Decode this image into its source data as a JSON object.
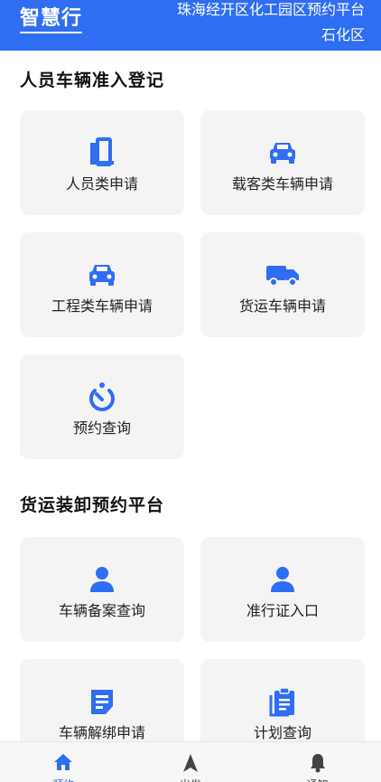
{
  "header": {
    "logo": "智慧行",
    "platform_name": "珠海经开区化工园区预约平台",
    "platform_sub": "石化区"
  },
  "sections": [
    {
      "title": "人员车辆准入登记",
      "cards": [
        {
          "label": "人员类申请",
          "icon": "door-icon"
        },
        {
          "label": "载客类车辆申请",
          "icon": "car-icon"
        },
        {
          "label": "工程类车辆申请",
          "icon": "car-icon"
        },
        {
          "label": "货运车辆申请",
          "icon": "truck-icon"
        },
        {
          "label": "预约查询",
          "icon": "timer-icon"
        }
      ]
    },
    {
      "title": "货运装卸预约平台",
      "cards": [
        {
          "label": "车辆备案查询",
          "icon": "person-icon"
        },
        {
          "label": "准行证入口",
          "icon": "person-icon"
        },
        {
          "label": "车辆解绑申请",
          "icon": "document-icon"
        },
        {
          "label": "计划查询",
          "icon": "clipboard-icon"
        }
      ]
    }
  ],
  "tabbar": [
    {
      "label": "预约",
      "icon": "home-icon",
      "active": true
    },
    {
      "label": "出发",
      "icon": "navigation-icon",
      "active": false
    },
    {
      "label": "通知",
      "icon": "bell-icon",
      "active": false
    }
  ],
  "colors": {
    "primary": "#2f6ef2",
    "card_bg": "#f4f4f4"
  }
}
